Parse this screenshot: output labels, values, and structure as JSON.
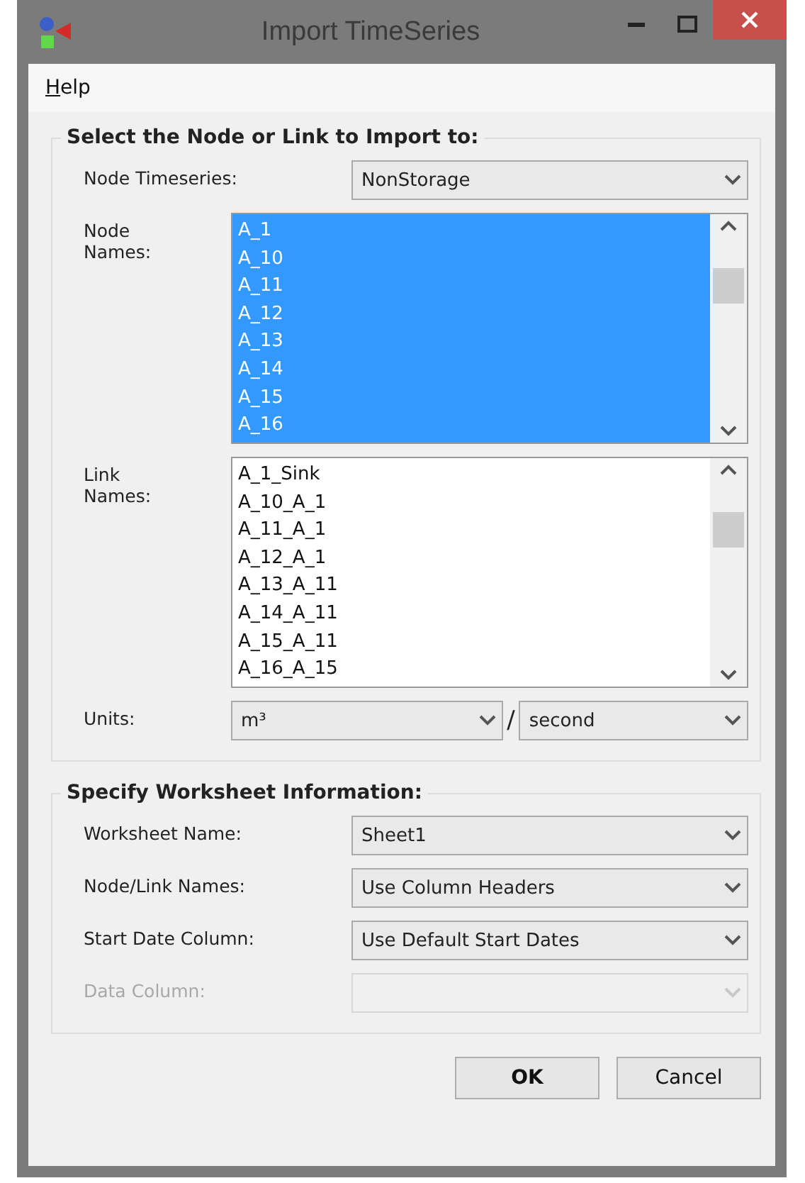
{
  "window": {
    "title": "Import TimeSeries"
  },
  "menu": [
    {
      "label": "Help",
      "mnemonic_underlined": true
    }
  ],
  "node_group": {
    "title": "Select the Node or Link to Import to:",
    "node_timeseries": {
      "label": "Node Timeseries:",
      "value": "NonStorage"
    },
    "node_names": {
      "label": "Node Names:",
      "items": [
        {
          "text": "A_1",
          "selected": true
        },
        {
          "text": "A_10",
          "selected": true
        },
        {
          "text": "A_11",
          "selected": true
        },
        {
          "text": "A_12",
          "selected": true
        },
        {
          "text": "A_13",
          "selected": true
        },
        {
          "text": "A_14",
          "selected": true
        },
        {
          "text": "A_15",
          "selected": true
        },
        {
          "text": "A_16",
          "selected": true
        }
      ]
    },
    "link_names": {
      "label": "Link Names:",
      "items": [
        {
          "text": "A_1_Sink",
          "selected": false
        },
        {
          "text": "A_10_A_1",
          "selected": false
        },
        {
          "text": "A_11_A_1",
          "selected": false
        },
        {
          "text": "A_12_A_1",
          "selected": false
        },
        {
          "text": "A_13_A_11",
          "selected": false
        },
        {
          "text": "A_14_A_11",
          "selected": false
        },
        {
          "text": "A_15_A_11",
          "selected": false
        },
        {
          "text": "A_16_A_15",
          "selected": false
        }
      ]
    },
    "units": {
      "label": "Units:",
      "numerator": "m³",
      "separator": "/",
      "denominator": "second"
    }
  },
  "worksheet_group": {
    "title": "Specify Worksheet Information:",
    "fields": [
      {
        "label": "Worksheet Name:",
        "value": "Sheet1",
        "disabled": false
      },
      {
        "label": "Node/Link Names:",
        "value": "Use Column Headers",
        "disabled": false
      },
      {
        "label": "Start Date Column:",
        "value": "Use Default Start Dates",
        "disabled": false
      },
      {
        "label": "Data Column:",
        "disabled": true
      }
    ]
  },
  "buttons": [
    {
      "label": "OK",
      "default": true
    },
    {
      "label": "Cancel",
      "default": false
    }
  ]
}
